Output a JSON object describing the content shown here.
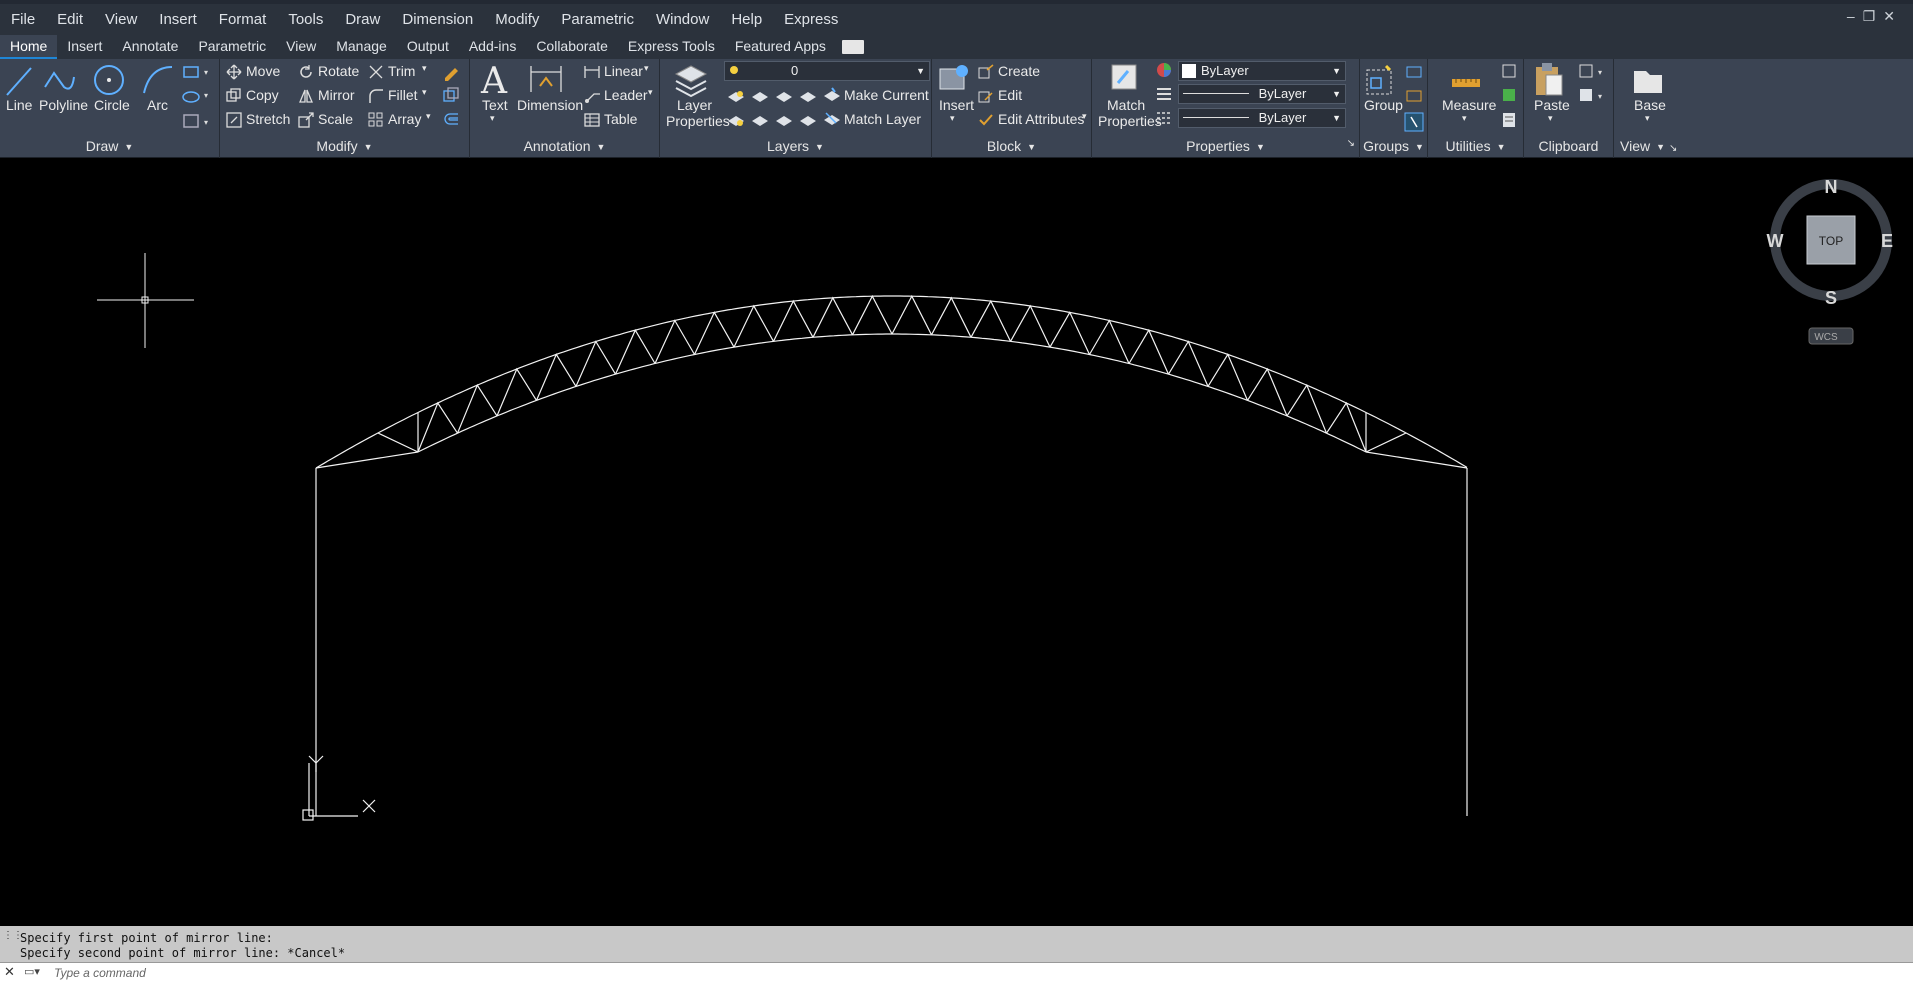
{
  "menu": [
    "File",
    "Edit",
    "View",
    "Insert",
    "Format",
    "Tools",
    "Draw",
    "Dimension",
    "Modify",
    "Parametric",
    "Window",
    "Help",
    "Express"
  ],
  "tabs": [
    "Home",
    "Insert",
    "Annotate",
    "Parametric",
    "View",
    "Manage",
    "Output",
    "Add-ins",
    "Collaborate",
    "Express Tools",
    "Featured Apps"
  ],
  "active_tab": "Home",
  "panels": {
    "draw": {
      "title": "Draw",
      "line": "Line",
      "polyline": "Polyline",
      "circle": "Circle",
      "arc": "Arc"
    },
    "modify": {
      "title": "Modify",
      "move": "Move",
      "rotate": "Rotate",
      "trim": "Trim",
      "copy": "Copy",
      "mirror": "Mirror",
      "fillet": "Fillet",
      "stretch": "Stretch",
      "scale": "Scale",
      "array": "Array"
    },
    "annotation": {
      "title": "Annotation",
      "text": "Text",
      "dimension": "Dimension",
      "linear": "Linear",
      "leader": "Leader",
      "table": "Table"
    },
    "layers": {
      "title": "Layers",
      "layer_properties_1": "Layer",
      "layer_properties_2": "Properties",
      "current_layer": "0",
      "make_current": "Make Current",
      "match_layer": "Match Layer"
    },
    "block": {
      "title": "Block",
      "insert": "Insert",
      "create": "Create",
      "edit": "Edit",
      "edit_attributes": "Edit Attributes"
    },
    "properties": {
      "title": "Properties",
      "match_1": "Match",
      "match_2": "Properties",
      "color": "ByLayer",
      "linetype": "ByLayer",
      "lineweight": "ByLayer"
    },
    "groups": {
      "title": "Groups",
      "group": "Group"
    },
    "utilities": {
      "title": "Utilities",
      "measure": "Measure"
    },
    "clipboard": {
      "title": "Clipboard",
      "paste": "Paste"
    },
    "view": {
      "title": "View",
      "base": "Base"
    }
  },
  "viewcube": {
    "north": "N",
    "south": "S",
    "east": "E",
    "west": "W",
    "face": "TOP",
    "wcs": "WCS"
  },
  "ucs": {
    "x": "X",
    "y": "Y"
  },
  "command_history": [
    "Specify first point of mirror line:",
    "Specify second point of mirror line: *Cancel*"
  ],
  "command_placeholder": "Type a command",
  "colors": {
    "accent": "#1f86d6",
    "ribbon": "#3b4453",
    "canvas": "#000000"
  }
}
